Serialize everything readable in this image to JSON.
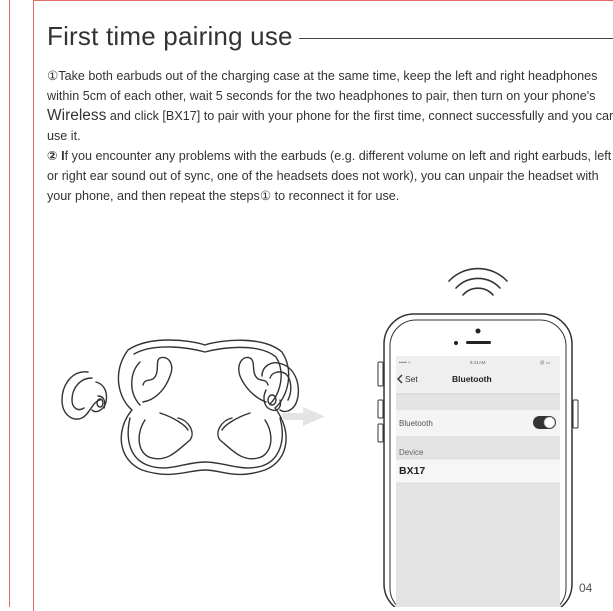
{
  "title": "First time pairing use",
  "step1": {
    "before_brand": "①Take both earbuds out of the charging case at the same time, keep the left and right headphones within 5cm of each other, wait 5 seconds for the two headphones to pair, then turn on your phone's ",
    "brand_word": "Wireless",
    "after_brand": " and click [BX17] to pair with your phone for the first time, connect successfully and you can use it."
  },
  "step2": {
    "lead": "② I",
    "text": "f you encounter any problems with the earbuds (e.g. different volume on left and right earbuds, left or right ear sound out of sync, one of the headsets does not work), you can unpair the headset with your phone, and then repeat the steps① to reconnect it for use."
  },
  "phone": {
    "status_left": "••••• ≈",
    "status_center": "9:41AM",
    "status_right": "@ ▭",
    "back_label": "Set",
    "header_title": "Bluetooth",
    "row_bluetooth_label": "Bluetooth",
    "bluetooth_on": true,
    "device_section_label": "Device",
    "device_name": "BX17"
  },
  "icons": {
    "signal": "wireless-signal-icon",
    "arrow": "arrow-right-icon",
    "case": "earbuds-charging-case",
    "toggle": "toggle-switch-icon"
  },
  "page_number": "04"
}
